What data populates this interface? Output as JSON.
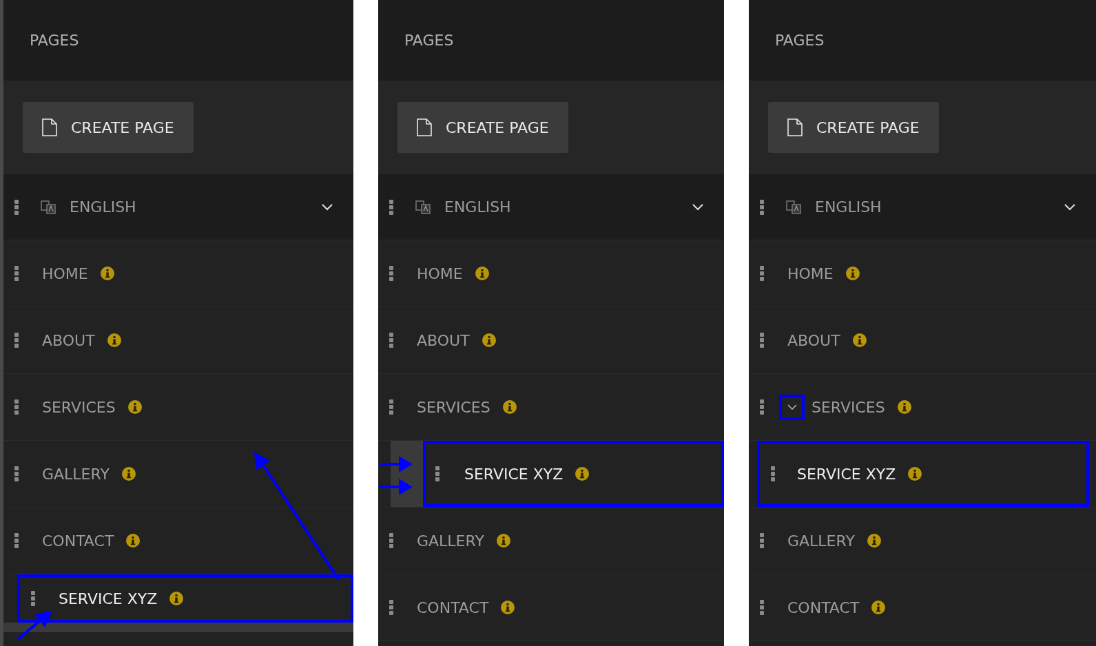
{
  "panels": [
    {
      "title": "PAGES",
      "create_button": "CREATE PAGE",
      "language": "ENGLISH",
      "drag_arrows": true,
      "drop_arrows": false,
      "pages": [
        {
          "label": "HOME",
          "kind": "page",
          "highlighted": false
        },
        {
          "label": "ABOUT",
          "kind": "page",
          "highlighted": false
        },
        {
          "label": "SERVICES",
          "kind": "page",
          "highlighted": false
        },
        {
          "label": "GALLERY",
          "kind": "page",
          "highlighted": false
        },
        {
          "label": "CONTACT",
          "kind": "page",
          "highlighted": false
        },
        {
          "label": "SERVICE XYZ",
          "kind": "dragged",
          "highlighted": true
        }
      ]
    },
    {
      "title": "PAGES",
      "create_button": "CREATE PAGE",
      "language": "ENGLISH",
      "drag_arrows": false,
      "drop_arrows": true,
      "pages": [
        {
          "label": "HOME",
          "kind": "page",
          "highlighted": false
        },
        {
          "label": "ABOUT",
          "kind": "page",
          "highlighted": false
        },
        {
          "label": "SERVICES",
          "kind": "page",
          "highlighted": false,
          "children": [
            {
              "label": "SERVICE XYZ",
              "kind": "drop-target",
              "highlighted": true
            }
          ]
        },
        {
          "label": "GALLERY",
          "kind": "page",
          "highlighted": false
        },
        {
          "label": "CONTACT",
          "kind": "page",
          "highlighted": false
        }
      ]
    },
    {
      "title": "PAGES",
      "create_button": "CREATE PAGE",
      "language": "ENGLISH",
      "drag_arrows": false,
      "drop_arrows": false,
      "pages": [
        {
          "label": "HOME",
          "kind": "page",
          "highlighted": false
        },
        {
          "label": "ABOUT",
          "kind": "page",
          "highlighted": false
        },
        {
          "label": "SERVICES",
          "kind": "page",
          "highlighted": false,
          "expanded": true,
          "toggle_marked": true,
          "children": [
            {
              "label": "SERVICE XYZ",
              "kind": "child",
              "highlighted": true
            }
          ]
        },
        {
          "label": "GALLERY",
          "kind": "page",
          "highlighted": false
        },
        {
          "label": "CONTACT",
          "kind": "page",
          "highlighted": false
        }
      ]
    }
  ]
}
